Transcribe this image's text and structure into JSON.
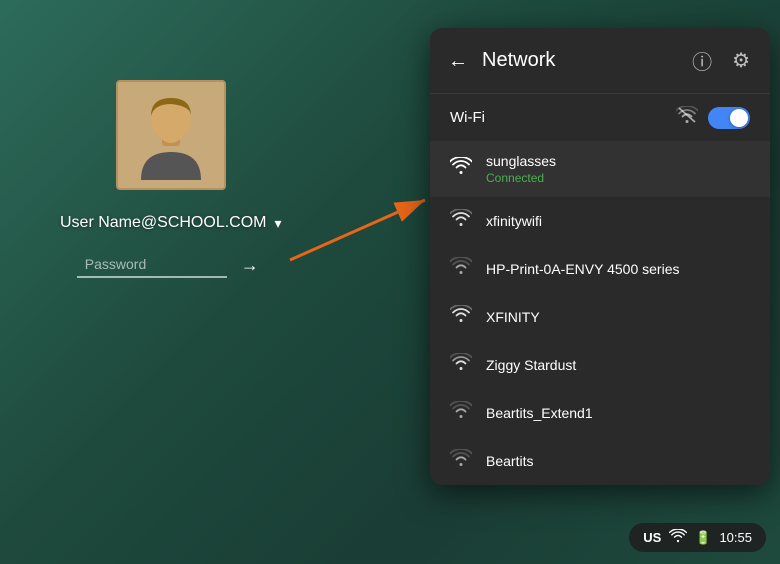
{
  "background": {
    "color": "#2d5a4e"
  },
  "login": {
    "user_name": "User Name@SCHOOL.COM",
    "password_placeholder": "Password",
    "chevron": "▾",
    "arrow_label": "→"
  },
  "network_panel": {
    "title": "Network",
    "back_icon": "←",
    "info_icon": "ⓘ",
    "settings_icon": "⚙",
    "wifi_section_label": "Wi-Fi",
    "wifi_enabled": true,
    "networks": [
      {
        "name": "sunglasses",
        "status": "Connected",
        "signal": "full",
        "connected": true
      },
      {
        "name": "xfinitywifi",
        "status": "",
        "signal": "medium",
        "connected": false
      },
      {
        "name": "HP-Print-0A-ENVY 4500 series",
        "status": "",
        "signal": "low",
        "connected": false
      },
      {
        "name": "XFINITY",
        "status": "",
        "signal": "medium",
        "connected": false
      },
      {
        "name": "Ziggy Stardust",
        "status": "",
        "signal": "medium",
        "connected": false
      },
      {
        "name": "Beartits_Extend1",
        "status": "",
        "signal": "low",
        "connected": false
      },
      {
        "name": "Beartits",
        "status": "",
        "signal": "low",
        "connected": false
      }
    ]
  },
  "status_bar": {
    "country": "US",
    "time": "10:55"
  }
}
